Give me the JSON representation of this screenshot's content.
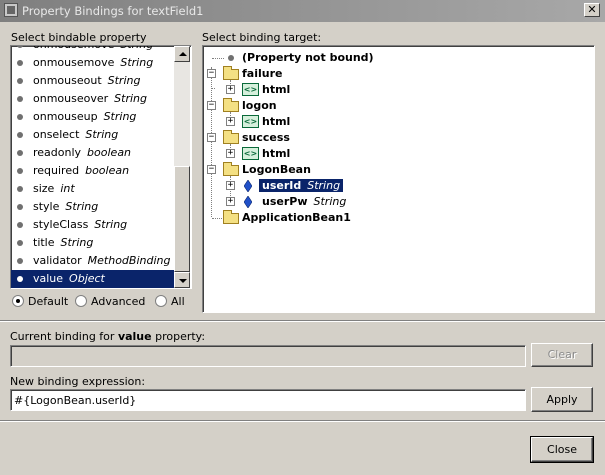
{
  "window": {
    "title": "Property Bindings for textField1"
  },
  "left": {
    "label": "Select bindable property",
    "properties": [
      {
        "name": "onmousemove",
        "type": "String"
      },
      {
        "name": "onmousemove",
        "type": "String"
      },
      {
        "name": "onmouseout",
        "type": "String"
      },
      {
        "name": "onmouseover",
        "type": "String"
      },
      {
        "name": "onmouseup",
        "type": "String"
      },
      {
        "name": "onselect",
        "type": "String"
      },
      {
        "name": "readonly",
        "type": "boolean"
      },
      {
        "name": "required",
        "type": "boolean"
      },
      {
        "name": "size",
        "type": "int"
      },
      {
        "name": "style",
        "type": "String"
      },
      {
        "name": "styleClass",
        "type": "String"
      },
      {
        "name": "title",
        "type": "String"
      },
      {
        "name": "validator",
        "type": "MethodBinding"
      },
      {
        "name": "value",
        "type": "Object",
        "selected": true
      }
    ],
    "radios": [
      {
        "label": "Default",
        "checked": true
      },
      {
        "label": "Advanced",
        "checked": false
      },
      {
        "label": "All",
        "checked": false
      }
    ]
  },
  "right": {
    "label": "Select binding target:",
    "tree": {
      "not_bound": "(Property not bound)",
      "failure": "failure",
      "logon": "logon",
      "success": "success",
      "html": "html",
      "logonbean": "LogonBean",
      "userid": "userId",
      "userid_type": "String",
      "userpw": "userPw",
      "userpw_type": "String",
      "appbean": "ApplicationBean1"
    }
  },
  "current": {
    "label_prefix": "Current binding for ",
    "label_bold": "value",
    "label_suffix": " property:",
    "value": "",
    "clear_label": "Clear"
  },
  "new_expr": {
    "label": "New binding expression:",
    "value": "#{LogonBean.userId}",
    "apply_label": "Apply"
  },
  "footer": {
    "close_label": "Close"
  }
}
